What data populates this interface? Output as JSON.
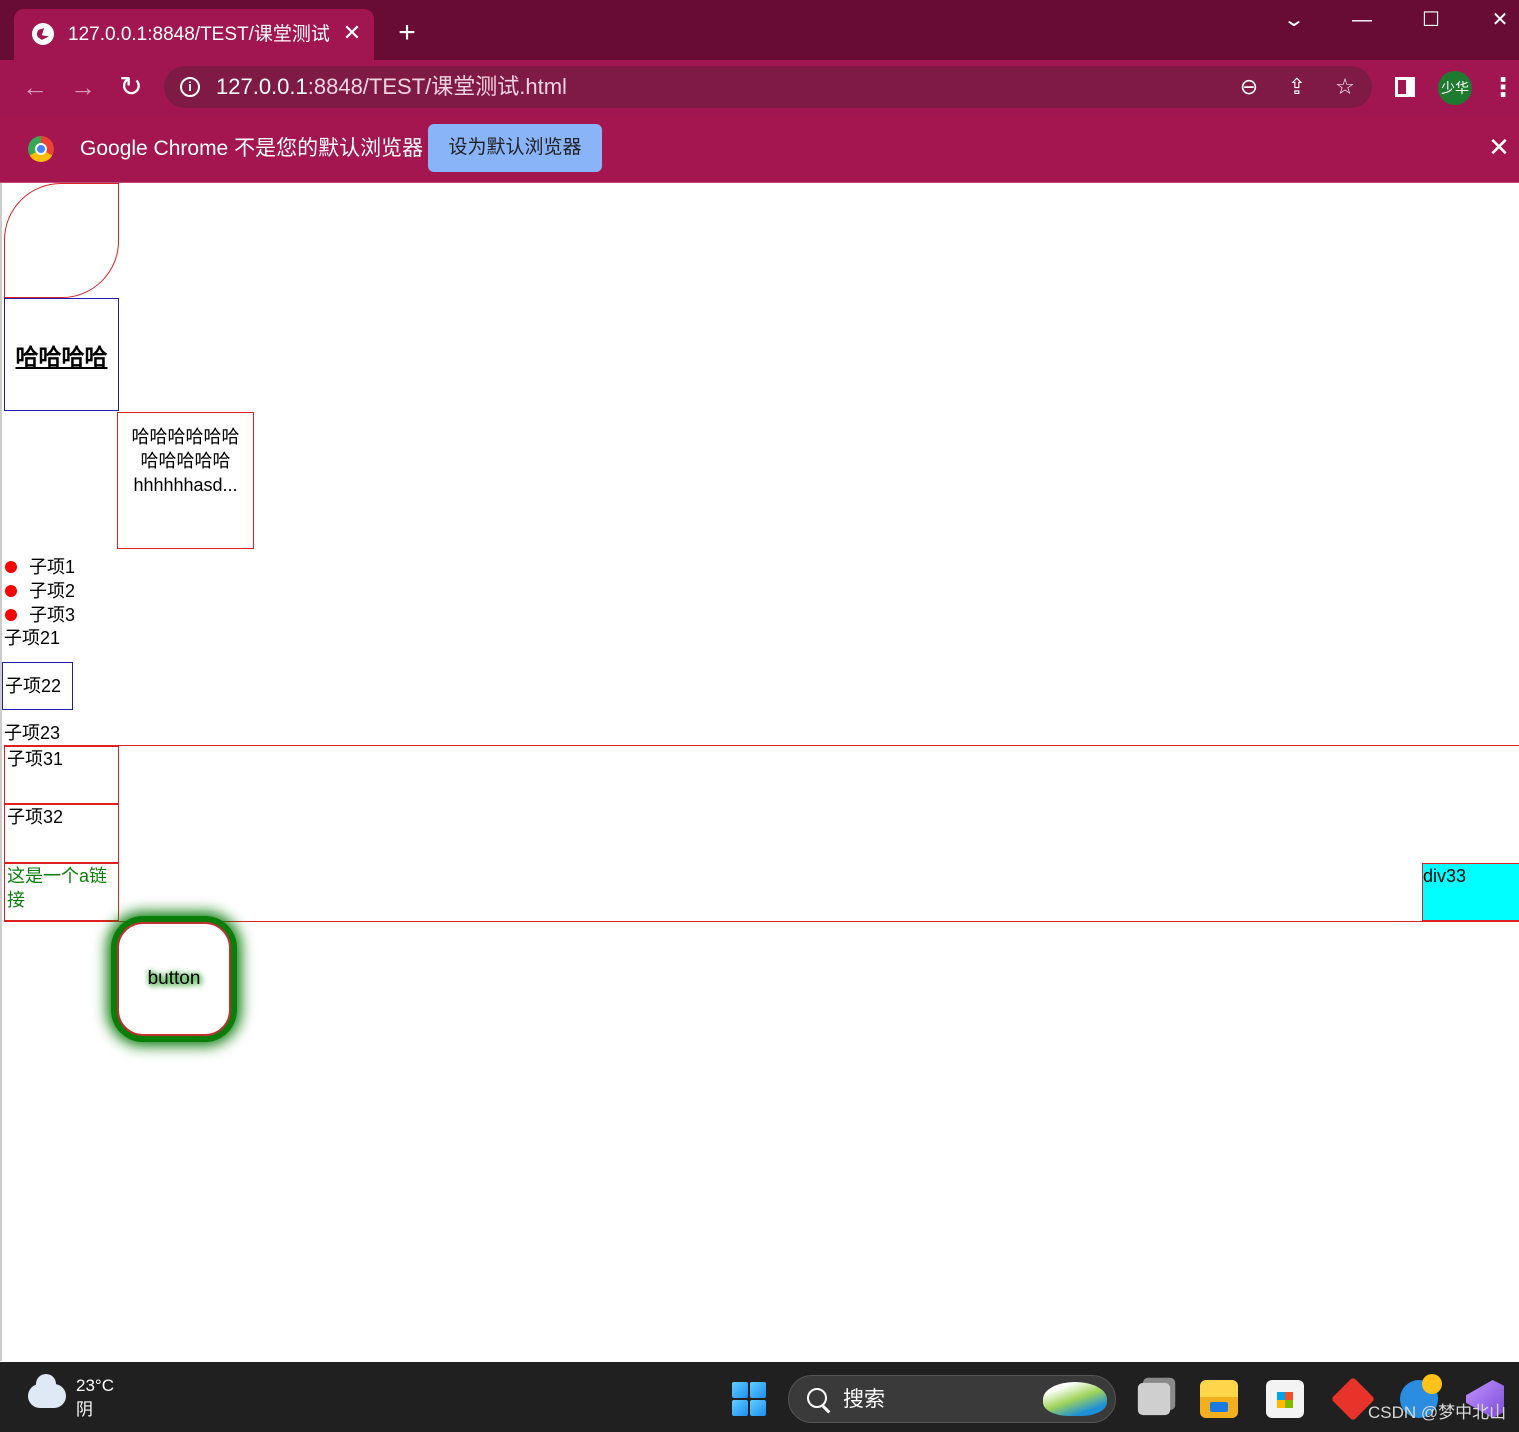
{
  "browser": {
    "tab_title": "127.0.0.1:8848/TEST/课堂测试.h",
    "tab_close_glyph": "✕",
    "new_tab_glyph": "+",
    "url_host": "127.0.0.1",
    "url_path": ":8848/TEST/课堂测试.html",
    "profile_name": "少华",
    "accent_color": "#a11650",
    "titlebar_color": "#680c33"
  },
  "infobar": {
    "message": "Google Chrome 不是您的默认浏览器",
    "button_label": "设为默认浏览器",
    "button_color": "#8ab4f8"
  },
  "page": {
    "heading": "哈哈哈哈",
    "text_box_lines": [
      "哈哈哈哈哈哈",
      "哈哈哈哈哈",
      "hhhhhhasd..."
    ],
    "bullet_list": [
      "子项1",
      "子项2",
      "子项3"
    ],
    "list2": [
      "子项21",
      "子项22",
      "子项23"
    ],
    "flex_items": [
      "子项31",
      "子项32",
      "这是一个a链接"
    ],
    "div33_label": "div33",
    "div33_color": "#00ffff",
    "link_color": "#0a7d0a",
    "button_label": "button"
  },
  "taskbar": {
    "weather_temp": "23°C",
    "weather_condition": "阴",
    "search_label": "搜索",
    "watermark": "CSDN @梦中北山"
  }
}
